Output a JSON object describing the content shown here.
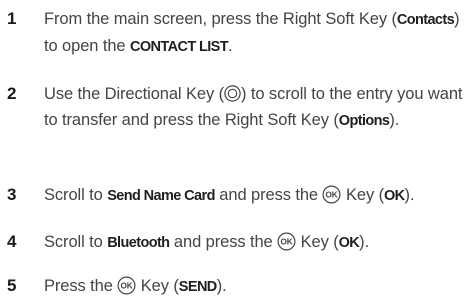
{
  "steps": [
    {
      "number": "1",
      "parts": [
        {
          "text": "From the main screen, press the Right Soft Key ("
        },
        {
          "kw": "Contacts"
        },
        {
          "text": ") to open the "
        },
        {
          "kw": "CONTACT LIST"
        },
        {
          "text": "."
        }
      ]
    },
    {
      "number": "2",
      "parts": [
        {
          "text": "Use the Directional Key ("
        },
        {
          "icon": "directional-key-icon"
        },
        {
          "text": ") to scroll to the entry you want to transfer and press the Right Soft Key ("
        },
        {
          "kw": "Options"
        },
        {
          "text": ")."
        }
      ]
    },
    {
      "number": "3",
      "parts": [
        {
          "text": "Scroll to "
        },
        {
          "kw": "Send Name Card"
        },
        {
          "text": " and press the "
        },
        {
          "icon": "ok-key-icon"
        },
        {
          "text": " Key ("
        },
        {
          "kw": "OK"
        },
        {
          "text": ")."
        }
      ]
    },
    {
      "number": "4",
      "parts": [
        {
          "text": "Scroll to "
        },
        {
          "kw": "Bluetooth"
        },
        {
          "text": " and press the "
        },
        {
          "icon": "ok-key-icon"
        },
        {
          "text": " Key ("
        },
        {
          "kw": "OK"
        },
        {
          "text": ")."
        }
      ]
    },
    {
      "number": "5",
      "parts": [
        {
          "text": "Press the "
        },
        {
          "icon": "ok-key-icon"
        },
        {
          "text": " Key ("
        },
        {
          "kw": "SEND"
        },
        {
          "text": ")."
        }
      ]
    }
  ]
}
